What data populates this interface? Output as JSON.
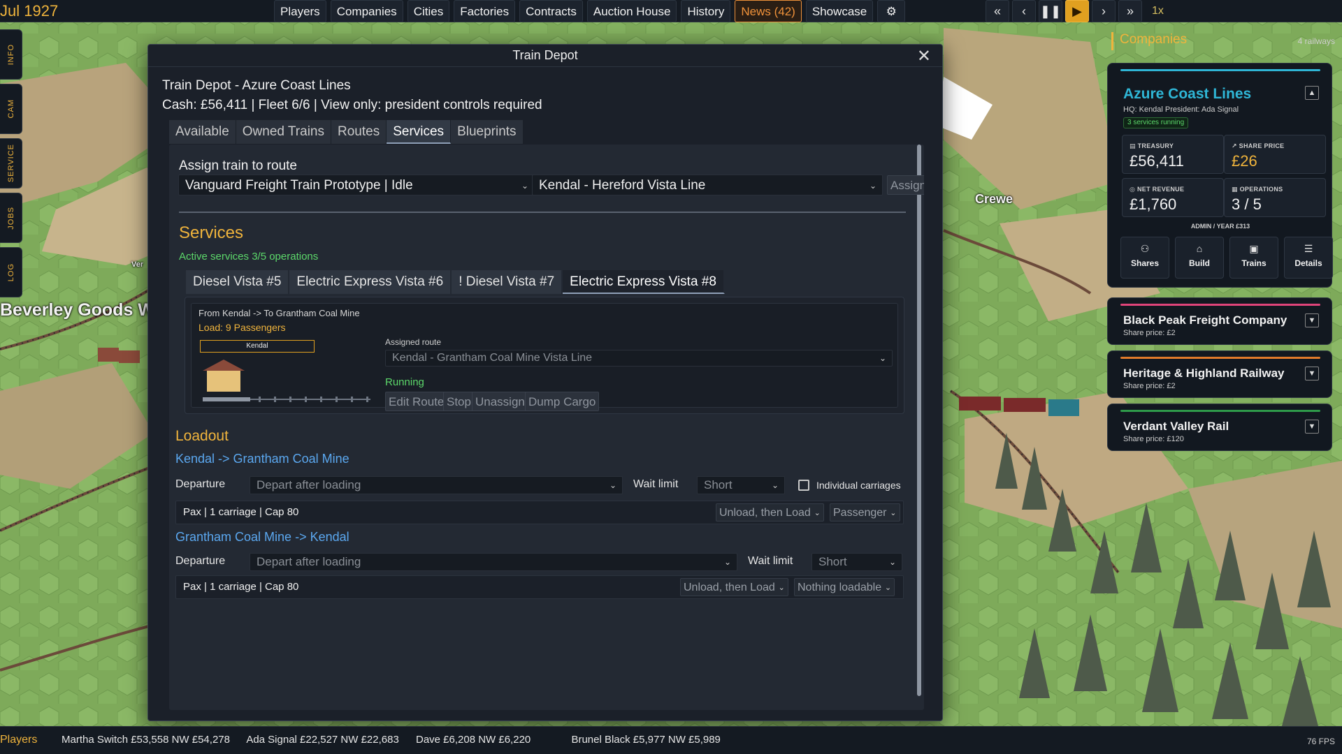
{
  "topbar": {
    "date": "Jul 1927",
    "nav": [
      "Players",
      "Companies",
      "Cities",
      "Factories",
      "Contracts",
      "Auction House",
      "History",
      "News (42)",
      "Showcase"
    ],
    "settings_icon": "gear-icon",
    "speed_label": "1x"
  },
  "sidetabs": [
    "INFO",
    "CAM",
    "SERVICE",
    "JOBS",
    "LOG"
  ],
  "map": {
    "labels": [
      "Beverley Goods Wo",
      "Crewe",
      "Ver"
    ]
  },
  "depot": {
    "title": "Train Depot",
    "subtitle": "Train Depot - Azure Coast Lines",
    "info": "Cash: £56,411 | Fleet 6/6 | View only: president controls required",
    "tabs": [
      "Available",
      "Owned Trains",
      "Routes",
      "Services",
      "Blueprints"
    ],
    "active_tab": "Services",
    "assign": {
      "heading": "Assign train to route",
      "train_value": "Vanguard Freight Train Prototype | Idle",
      "route_value": "Kendal - Hereford Vista Line",
      "button": "Assign"
    },
    "services": {
      "heading": "Services",
      "active_text": "Active services 3/5 operations",
      "tabs": [
        "Diesel Vista #5",
        "Electric Express Vista #6",
        "! Diesel Vista #7",
        "Electric Express Vista #8"
      ],
      "active_tab": "Electric Express Vista #8",
      "card": {
        "from_to": "From Kendal  ->  To Grantham Coal Mine",
        "load": "Load: 9 Passengers",
        "station": "Kendal",
        "assigned_route_label": "Assigned route",
        "assigned_route_value": "Kendal - Grantham Coal Mine Vista Line",
        "status": "Running",
        "buttons": [
          "Edit Route",
          "Stop",
          "Unassign",
          "Dump Cargo"
        ]
      }
    },
    "loadout": {
      "heading": "Loadout",
      "legs": [
        {
          "route": "Kendal -> Grantham Coal Mine",
          "departure_label": "Departure",
          "departure_value": "Depart after loading",
          "wait_label": "Wait limit",
          "wait_value": "Short",
          "individual_label": "Individual carriages",
          "pax": "Pax | 1 carriage | Cap 80",
          "action": "Unload, then Load",
          "cargo": "Passenger"
        },
        {
          "route": "Grantham Coal Mine -> Kendal",
          "departure_label": "Departure",
          "departure_value": "Depart after loading",
          "wait_label": "Wait limit",
          "wait_value": "Short",
          "pax": "Pax | 1 carriage | Cap 80",
          "action": "Unload, then Load",
          "cargo": "Nothing loadable"
        }
      ]
    }
  },
  "companies": {
    "title": "Companies",
    "count": "4 railways",
    "azure": {
      "name": "Azure Coast Lines",
      "hq": "HQ: Kendal   President: Ada Signal",
      "badge": "3 services running",
      "color": "#2fb6d6",
      "stats": [
        {
          "label": "TREASURY",
          "value": "£56,411"
        },
        {
          "label": "SHARE PRICE",
          "value": "£26"
        },
        {
          "label": "NET REVENUE",
          "value": "£1,760"
        },
        {
          "label": "OPERATIONS",
          "value": "3 / 5"
        }
      ],
      "admin": "ADMIN / YEAR   £313",
      "actions": [
        "Shares",
        "Build",
        "Trains",
        "Details"
      ]
    },
    "others": [
      {
        "name": "Black Peak Freight Company",
        "price": "Share price: £2",
        "color": "#e0447a"
      },
      {
        "name": "Heritage & Highland Railway",
        "price": "Share price: £2",
        "color": "#e07a2a"
      },
      {
        "name": "Verdant Valley Rail",
        "price": "Share price: £120",
        "color": "#2e9a4a"
      }
    ]
  },
  "bottombar": {
    "label": "Players",
    "players": [
      "Martha Switch  £53,558  NW £54,278",
      "Ada Signal  £22,527  NW £22,683",
      "Dave  £6,208  NW £6,220",
      "Brunel Black  £5,977  NW £5,989"
    ],
    "fps": "76 FPS"
  }
}
